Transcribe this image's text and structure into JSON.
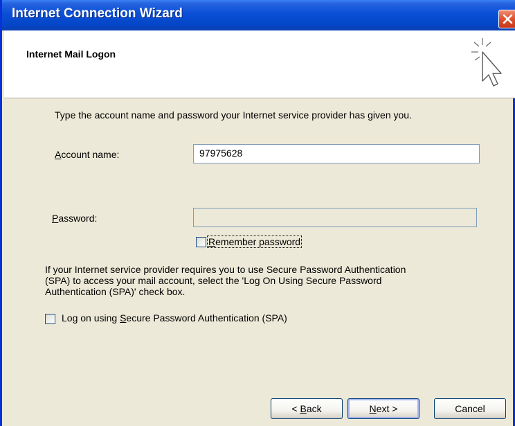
{
  "window": {
    "title": "Internet Connection Wizard"
  },
  "header": {
    "title": "Internet Mail Logon",
    "icon": "wizard-cursor-icon"
  },
  "instructions": "Type the account name and password your Internet service provider has given you.",
  "account": {
    "label_key": "A",
    "label_rest": "ccount name:",
    "value": "97975628"
  },
  "password": {
    "label_key": "P",
    "label_rest": "assword:",
    "value": ""
  },
  "remember": {
    "label_key": "R",
    "label_rest": "emember password",
    "checked": false
  },
  "spa_paragraph": {
    "line1": "If your Internet service provider requires you to use Secure Password Authentication",
    "line2": "(SPA) to access your mail account, select the 'Log On Using Secure Password",
    "line3": "Authentication (SPA)' check box."
  },
  "spa_checkbox": {
    "label_pre": "Log on using ",
    "label_key": "S",
    "label_rest": "ecure Password Authentication (SPA)",
    "checked": false
  },
  "buttons": {
    "back_arrow": "<",
    "back_key": "B",
    "back_rest": "ack",
    "next_key": "N",
    "next_rest": "ext",
    "next_arrow": ">",
    "cancel": "Cancel"
  },
  "colors": {
    "titlebar": "#0a4fd6",
    "dialog_bg": "#ece9d8",
    "close_button": "#e0502f"
  }
}
